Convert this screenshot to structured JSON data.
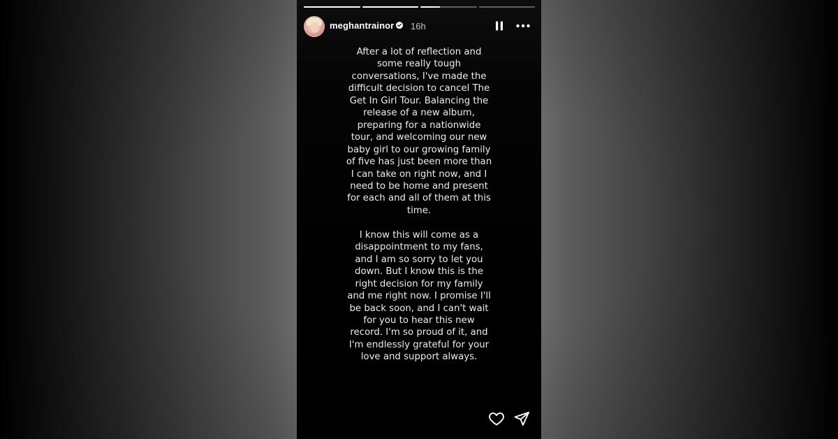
{
  "story": {
    "username": "meghantrainor",
    "verified": true,
    "timestamp": "16h",
    "progress_segments": [
      1.0,
      1.0,
      0.35,
      0.0
    ],
    "message_paragraphs": [
      "After a lot of reflection and some really tough conversations, I've made the difficult decision to cancel The Get In Girl Tour. Balancing the release of a new album, preparing for a nationwide tour, and welcoming our new baby girl to our growing family of five has just been more than I can take on right now, and I need to be home and present for each and all of them at this time.",
      "I know this will come as a disappointment to my fans, and I am so sorry to let you down. But I know this is the right decision for my family and me right now. I promise I'll be back soon, and I can't wait for you to hear this new record. I'm so proud of it, and I'm endlessly grateful for your love and support always."
    ]
  },
  "icons": {
    "avatar": "profile-photo",
    "verified": "verified-badge-icon",
    "pause": "pause-icon",
    "more": "more-options-icon",
    "like": "heart-icon",
    "share": "send-icon"
  },
  "colors": {
    "story_background": "#000000",
    "text": "#ececec",
    "progress_track": "rgba(255,255,255,0.35)",
    "progress_fill": "#ffffff",
    "verified_badge": "#ffffff"
  }
}
